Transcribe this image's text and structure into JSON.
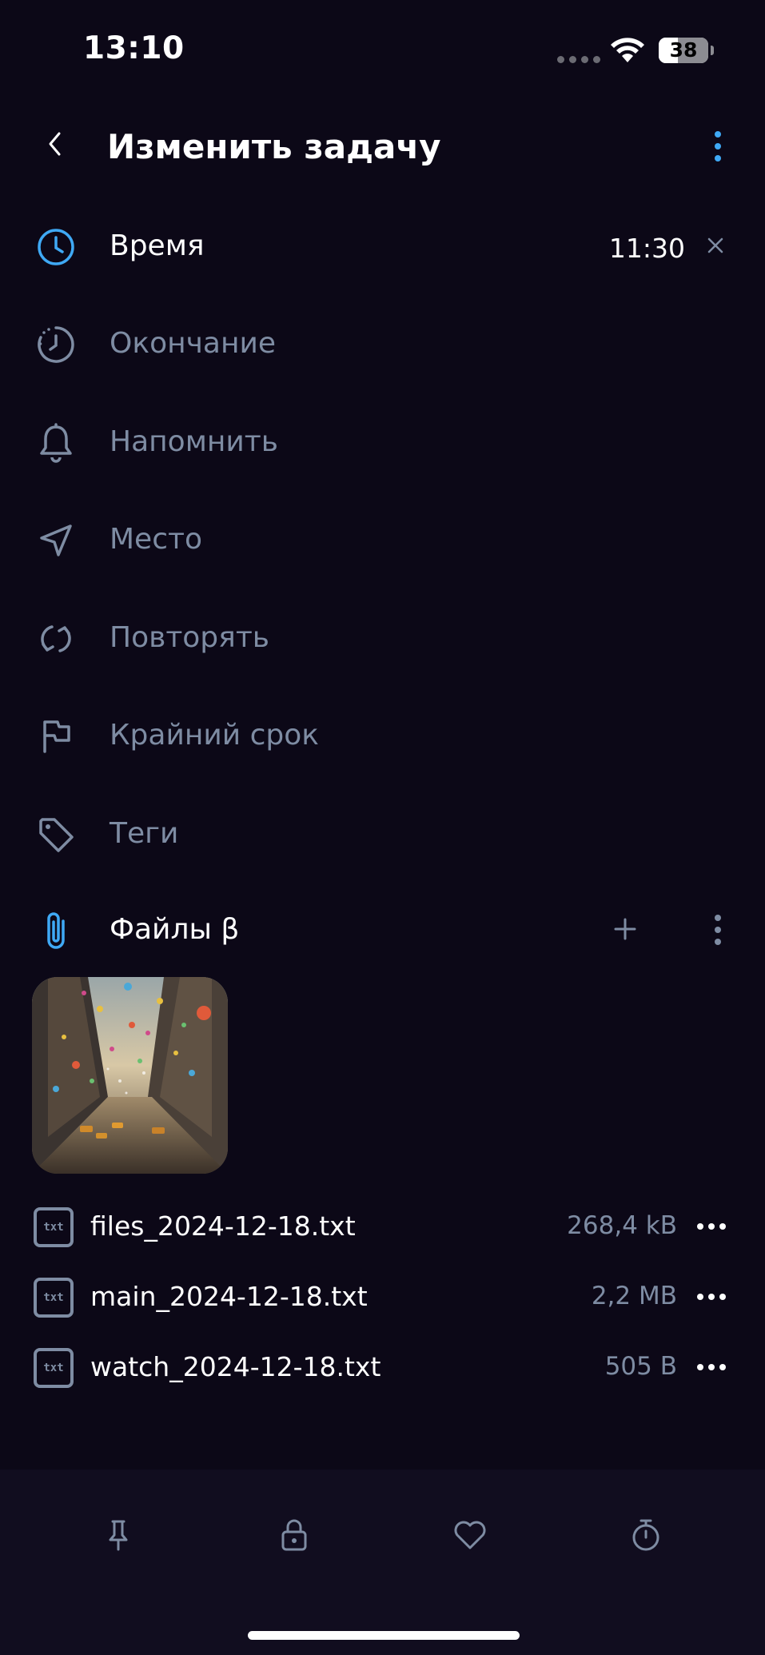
{
  "status_bar": {
    "time": "13:10",
    "battery": "38",
    "battery_level": 0.38
  },
  "header": {
    "title": "Изменить задачу"
  },
  "fields": [
    {
      "label": "Время",
      "value": "11:30",
      "active": true
    },
    {
      "label": "Окончание"
    },
    {
      "label": "Напомнить"
    },
    {
      "label": "Место"
    },
    {
      "label": "Повторять"
    },
    {
      "label": "Крайний срок"
    },
    {
      "label": "Теги"
    }
  ],
  "files_section": {
    "label": "Файлы β"
  },
  "files": [
    {
      "icon_text": "txt",
      "name": "files_2024-12-18.txt",
      "size": "268,4 kB"
    },
    {
      "icon_text": "txt",
      "name": "main_2024-12-18.txt",
      "size": "2,2 MB"
    },
    {
      "icon_text": "txt",
      "name": "watch_2024-12-18.txt",
      "size": "505 B"
    }
  ],
  "colors": {
    "background": "#0c0817",
    "accent": "#3fa9f5",
    "muted": "#7e8ca3",
    "bottom_bar": "#110d1f"
  },
  "icons": {
    "fields": [
      "clock-icon",
      "clock-end-icon",
      "bell-icon",
      "location-arrow-icon",
      "repeat-icon",
      "flag-icon",
      "tag-icon"
    ],
    "files_section": "paperclip-icon",
    "bottom_bar": [
      "pin-icon",
      "lock-icon",
      "heart-icon",
      "stopwatch-icon"
    ]
  }
}
